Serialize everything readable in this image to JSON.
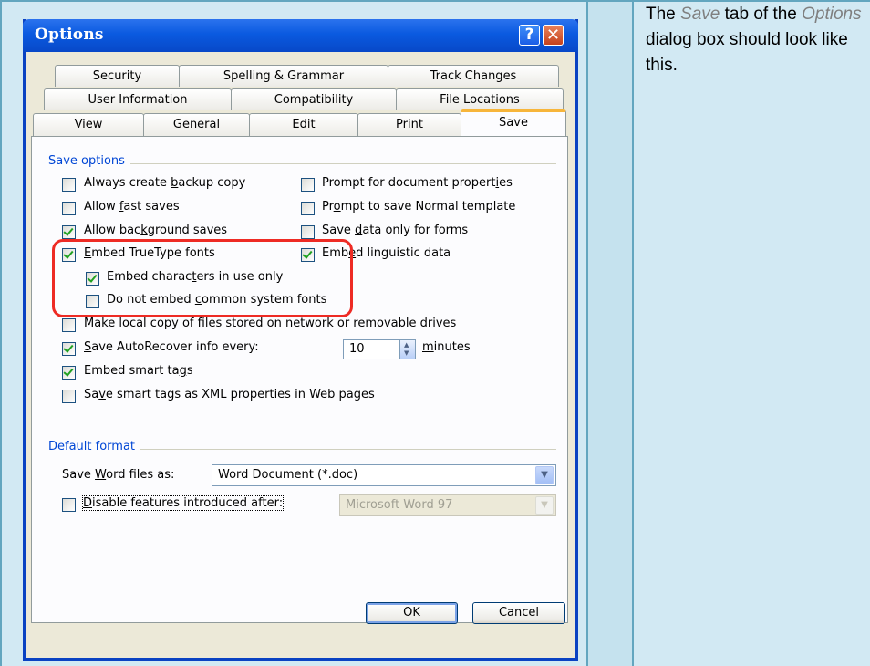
{
  "dialog": {
    "title": "Options",
    "help_glyph": "?",
    "close_glyph": "✕"
  },
  "tabs": {
    "row1": [
      "Security",
      "Spelling & Grammar",
      "Track Changes"
    ],
    "row2": [
      "User Information",
      "Compatibility",
      "File Locations"
    ],
    "row3": [
      "View",
      "General",
      "Edit",
      "Print",
      "Save"
    ],
    "active": "Save"
  },
  "save_options": {
    "group_label": "Save options",
    "left": [
      {
        "pre": "Always create ",
        "u": "b",
        "post": "ackup copy",
        "checked": false
      },
      {
        "pre": "Allow ",
        "u": "f",
        "post": "ast saves",
        "checked": false
      },
      {
        "pre": "Allow bac",
        "u": "k",
        "post": "ground saves",
        "checked": true
      },
      {
        "pre": "",
        "u": "E",
        "post": "mbed TrueType fonts",
        "checked": true
      }
    ],
    "right": [
      {
        "pre": "Prompt for document propert",
        "u": "i",
        "post": "es",
        "checked": false
      },
      {
        "pre": "Pr",
        "u": "o",
        "post": "mpt to save Normal template",
        "checked": false
      },
      {
        "pre": "Save ",
        "u": "d",
        "post": "ata only for forms",
        "checked": false
      },
      {
        "pre": "Emb",
        "u": "e",
        "post": "d linguistic data",
        "checked": true
      }
    ],
    "sub": [
      {
        "pre": "Embed charac",
        "u": "t",
        "post": "ers in use only",
        "checked": true
      },
      {
        "pre": "Do not embed ",
        "u": "c",
        "post": "ommon system fonts",
        "checked": false
      }
    ],
    "local_copy": {
      "pre": "Make local copy of files stored on ",
      "u": "n",
      "post": "etwork or removable drives",
      "checked": false
    },
    "autorecover": {
      "pre": "",
      "u": "S",
      "post": "ave AutoRecover info every:",
      "checked": true,
      "value": "10",
      "unit_u": "m",
      "unit_rest": "inutes"
    },
    "smart_tags": {
      "pre": "Embed smart ta",
      "u": "g",
      "post": "s",
      "checked": true
    },
    "smart_xml": {
      "pre": "Sa",
      "u": "v",
      "post": "e smart tags as XML properties in Web pages",
      "checked": false
    }
  },
  "default_format": {
    "group_label": "Default format",
    "save_as_pre": "Save ",
    "save_as_u": "W",
    "save_as_post": "ord files as:",
    "save_as_value": "Word Document (*.doc)",
    "disable_pre": "",
    "disable_u": "D",
    "disable_post": "isable features introduced after:",
    "disable_checked": false,
    "disable_value": "Microsoft Word 97"
  },
  "buttons": {
    "ok": "OK",
    "cancel": "Cancel"
  },
  "note": {
    "t1": "The ",
    "t2": "Save",
    "t3": " tab of the ",
    "t4": "Options",
    "t5": " dialog box should look like this."
  }
}
